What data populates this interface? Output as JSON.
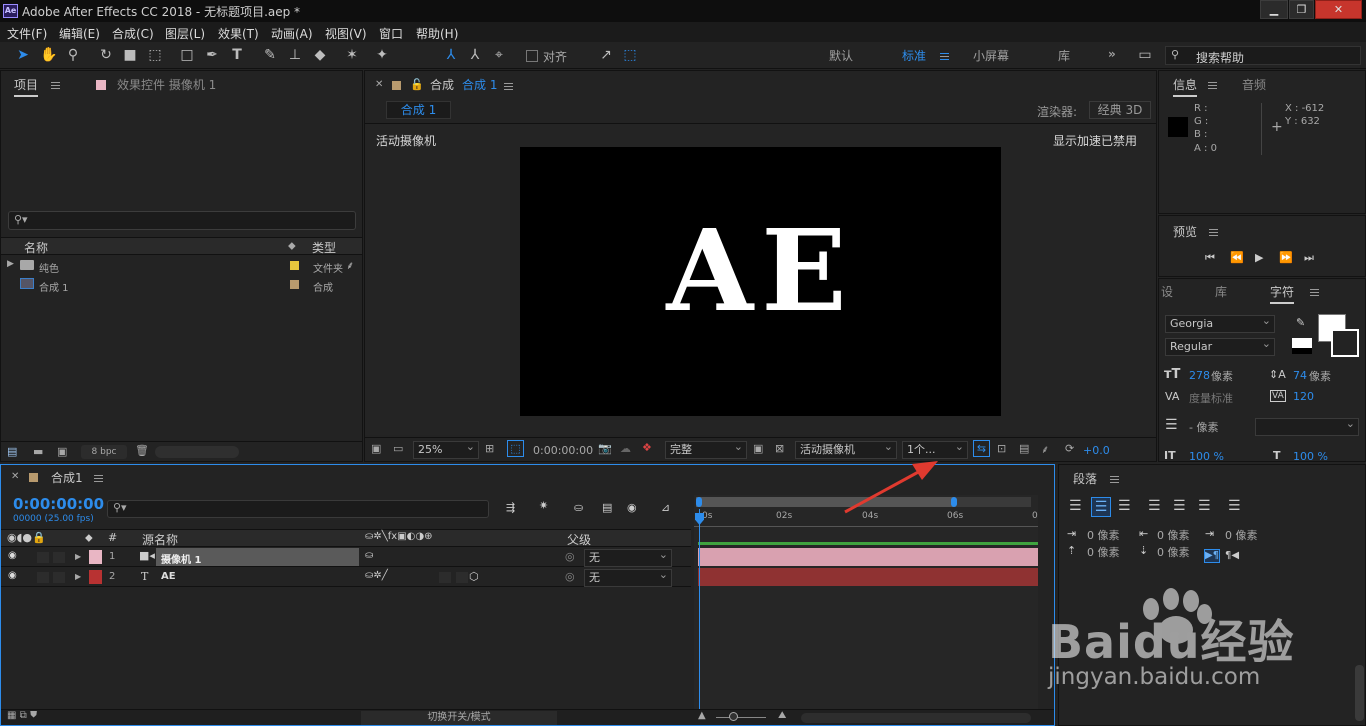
{
  "window": {
    "app_icon": "Ae",
    "title": "Adobe After Effects CC 2018 - 无标题项目.aep *",
    "minimize_icon": "minimize-icon",
    "maximize_icon": "maximize-icon",
    "close_icon": "close-icon"
  },
  "menu": [
    "文件(F)",
    "编辑(E)",
    "合成(C)",
    "图层(L)",
    "效果(T)",
    "动画(A)",
    "视图(V)",
    "窗口",
    "帮助(H)"
  ],
  "toolbar": {
    "align_label": "对齐",
    "workspaces": [
      "默认",
      "标准",
      "小屏幕",
      "库"
    ],
    "active_workspace": "标准",
    "search_placeholder": "搜索帮助"
  },
  "project_panel": {
    "tab_project": "项目",
    "tab_effects": "效果控件 摄像机 1",
    "col_name": "名称",
    "col_type": "类型",
    "items": [
      {
        "name": "纯色",
        "type": "文件夹",
        "label_color": "#e6c63d"
      },
      {
        "name": "合成 1",
        "type": "合成",
        "label_color": "#b89a6e"
      }
    ],
    "bpc": "8 bpc"
  },
  "composition_panel": {
    "tab_prefix": "合成",
    "tab_name": "合成 1",
    "flow_tab": "合成 1",
    "renderer_label": "渲染器:",
    "renderer_value": "经典 3D",
    "active_camera_label": "活动摄像机",
    "accel_label": "显示加速已禁用",
    "canvas_text": "AE",
    "zoom": "25%",
    "timecode": "0:00:00:00",
    "resolution": "完整",
    "camera_view": "活动摄像机",
    "views": "1个...",
    "exposure": "+0.0"
  },
  "info_panel": {
    "tab_info": "信息",
    "tab_audio": "音频",
    "r": "R :",
    "g": "G :",
    "b": "B :",
    "a": "A : 0",
    "x": "X : -612",
    "y": "Y : 632"
  },
  "preview_panel": {
    "title": "预览"
  },
  "character_panel": {
    "tab_1": "设",
    "tab_2": "库",
    "tab_3": "字符",
    "font": "Georgia",
    "style": "Regular",
    "size": "278",
    "size_unit": "像素",
    "leading": "74",
    "leading_unit": "像素",
    "kerning": "度量标准",
    "tracking": "120",
    "stroke": "- 像素",
    "vscale": "100 %",
    "hscale": "100 %"
  },
  "paragraph_panel": {
    "title": "段落",
    "indent_left": "0 像素",
    "indent_right": "0 像素",
    "indent_first": "0 像素",
    "space_before": "0 像素",
    "space_after": "0 像素"
  },
  "timeline": {
    "tab": "合成1",
    "timecode": "0:00:00:00",
    "fps": "00000 (25.00 fps)",
    "col_num": "#",
    "col_source": "源名称",
    "col_parent": "父级",
    "layers": [
      {
        "num": "1",
        "name": "摄像机 1",
        "parent": "无",
        "label_color": "#e9b6c4",
        "type_icon": "camera-icon"
      },
      {
        "num": "2",
        "name": "AE",
        "parent": "无",
        "label_color": "#b83232",
        "type_icon": "text-layer-icon"
      }
    ],
    "ruler": [
      "0s",
      "02s",
      "04s",
      "06s",
      "0"
    ],
    "footer_toggle": "切换开关/模式"
  },
  "watermark": {
    "brand": "Baidu经验",
    "url": "jingyan.baidu.com"
  },
  "colors": {
    "accent": "#2d8ceb",
    "red_arrow": "#e03a2f",
    "camera_bar": "#d08a9c",
    "text_bar": "#a23a3a"
  }
}
